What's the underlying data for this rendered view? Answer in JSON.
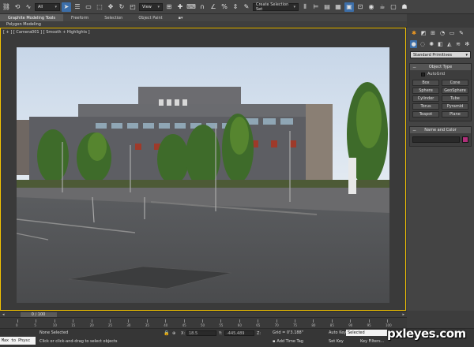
{
  "main_toolbar": {
    "filter_select": "All",
    "view_select": "View",
    "named_set_placeholder": "Create Selection Set",
    "icons": [
      "link-icon",
      "unlink-icon",
      "bind-icon",
      "select-icon",
      "select-by-name-icon",
      "rectangle-region-icon",
      "window-crossing-icon",
      "move-icon",
      "rotate-icon",
      "scale-icon",
      "snap-icon",
      "angle-snap-icon",
      "percent-snap-icon",
      "spinner-snap-icon",
      "edit-named-sets-icon",
      "mirror-icon",
      "align-icon",
      "layer-icon",
      "graphite-icon",
      "curve-editor-icon",
      "schematic-icon",
      "material-editor-icon",
      "render-setup-icon",
      "rendered-frame-icon",
      "render-icon"
    ]
  },
  "ribbon": {
    "tabs": [
      {
        "label": "Graphite Modeling Tools",
        "active": true
      },
      {
        "label": "Freeform",
        "active": false
      },
      {
        "label": "Selection",
        "active": false
      },
      {
        "label": "Object Paint",
        "active": false
      }
    ],
    "panel_label": "Polygon Modeling"
  },
  "viewport": {
    "label": "[ + ] [ Camera001 ] [ Smooth + Highlights ]",
    "border_color": "#f2c200"
  },
  "command_panel": {
    "category_dropdown": "Standard Primitives",
    "object_type_title": "Object Type",
    "autogrid_label": "AutoGrid",
    "object_buttons": [
      "Box",
      "Cone",
      "Sphere",
      "GeoSphere",
      "Cylinder",
      "Tube",
      "Torus",
      "Pyramid",
      "Teapot",
      "Plane"
    ],
    "name_color_title": "Name and Color",
    "object_color": "#b02f7a"
  },
  "time_slider": {
    "label": "0 / 100"
  },
  "trackbar": {
    "ticks": [
      "0",
      "5",
      "10",
      "15",
      "20",
      "25",
      "30",
      "35",
      "40",
      "45",
      "50",
      "55",
      "60",
      "65",
      "70",
      "75",
      "80",
      "85",
      "90",
      "95",
      "100"
    ]
  },
  "status": {
    "maxscript_text": "Max to Physc",
    "selection_text": "None Selected",
    "prompt_text": "Click or click-and-drag to select objects",
    "x_label": "X:",
    "y_label": "Y:",
    "z_label": "Z:",
    "x_value": "18.5",
    "y_value": "-445.489",
    "z_value": "0.0",
    "grid_text": "Grid = 0'3.188\"",
    "add_time_tag": "Add Time Tag",
    "auto_key": "Auto Key",
    "set_key": "Set Key",
    "selected_dropdown": "Selected",
    "key_filters": "Key Filters..."
  },
  "watermark": "pxleyes.com"
}
